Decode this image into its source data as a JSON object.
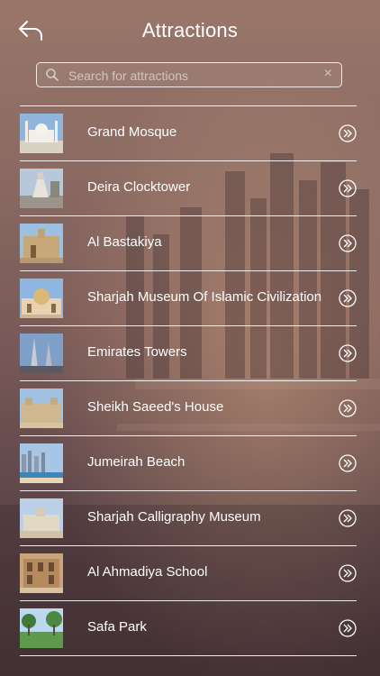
{
  "header": {
    "title": "Attractions"
  },
  "search": {
    "placeholder": "Search for attractions",
    "value": ""
  },
  "items": [
    {
      "label": "Grand Mosque"
    },
    {
      "label": "Deira Clocktower"
    },
    {
      "label": "Al Bastakiya"
    },
    {
      "label": "Sharjah Museum Of Islamic Civilization"
    },
    {
      "label": "Emirates Towers"
    },
    {
      "label": "Sheikh Saeed's House"
    },
    {
      "label": "Jumeirah Beach"
    },
    {
      "label": "Sharjah Calligraphy Museum"
    },
    {
      "label": "Al Ahmadiya School"
    },
    {
      "label": "Safa Park"
    }
  ]
}
